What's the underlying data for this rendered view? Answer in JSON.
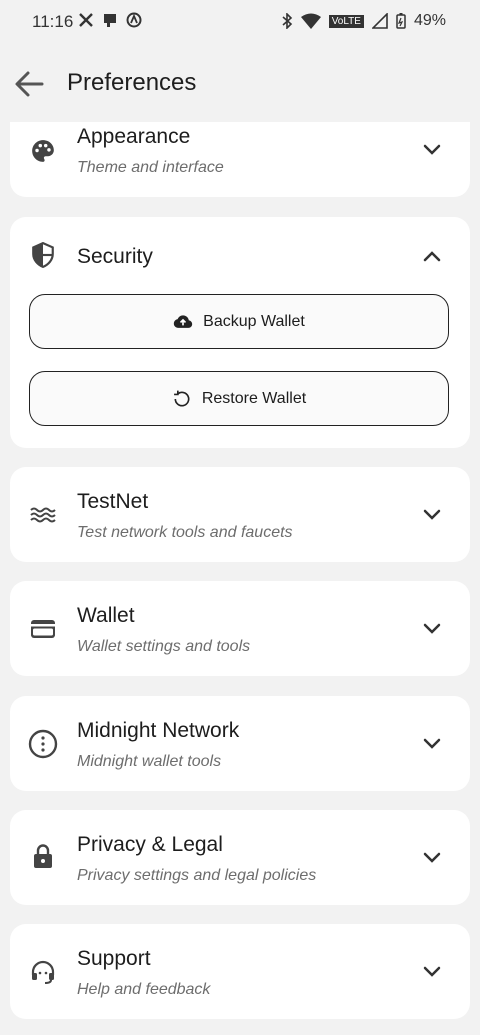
{
  "status_bar": {
    "time": "11:16",
    "network_label": "VoLTE",
    "battery": "49%"
  },
  "app_bar": {
    "title": "Preferences",
    "back_icon": "arrow-left-icon"
  },
  "sections": {
    "appearance": {
      "title": "Appearance",
      "subtitle": "Theme and interface",
      "icon": "palette-icon"
    },
    "security": {
      "title": "Security",
      "icon": "shield-icon",
      "backup_label": "Backup Wallet",
      "restore_label": "Restore Wallet"
    },
    "testnet": {
      "title": "TestNet",
      "subtitle": "Test network tools and faucets",
      "icon": "waves-icon"
    },
    "wallet": {
      "title": "Wallet",
      "subtitle": "Wallet settings and tools",
      "icon": "wallet-icon"
    },
    "midnight": {
      "title": "Midnight Network",
      "subtitle": "Midnight wallet tools",
      "icon": "info-circle-icon"
    },
    "privacy": {
      "title": "Privacy & Legal",
      "subtitle": "Privacy settings and legal policies",
      "icon": "lock-icon"
    },
    "support": {
      "title": "Support",
      "subtitle": "Help and feedback",
      "icon": "headset-icon"
    }
  }
}
